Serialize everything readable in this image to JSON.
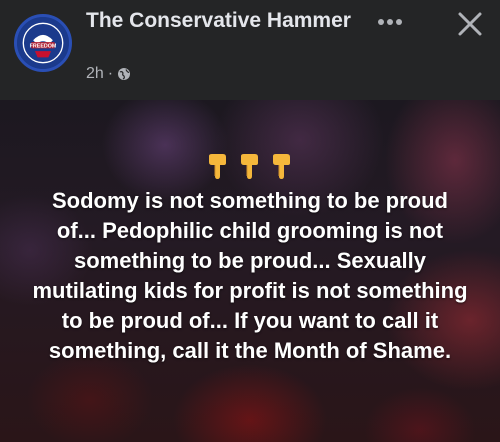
{
  "header": {
    "page_name": "The Conservative Hammer",
    "avatar_text": "FREEDOM",
    "timestamp": "2h",
    "separator": "·",
    "audience_icon": "globe-icon",
    "more_icon": "more-dots-icon",
    "close_icon": "close-icon"
  },
  "post": {
    "emoji_icons": [
      "point-down-icon",
      "point-down-icon",
      "point-down-icon"
    ],
    "text": "Sodomy is not something to be proud of... Pedophilic child grooming is not something to be proud... Sexually mutilating kids for profit is not something to be proud of... If you want to call it something, call it the Month of Shame."
  },
  "colors": {
    "background": "#242526",
    "primary_text": "#e4e6eb",
    "secondary_text": "#b0b3b8",
    "post_text": "#ffffff",
    "avatar_blue": "#1b3a8c"
  }
}
